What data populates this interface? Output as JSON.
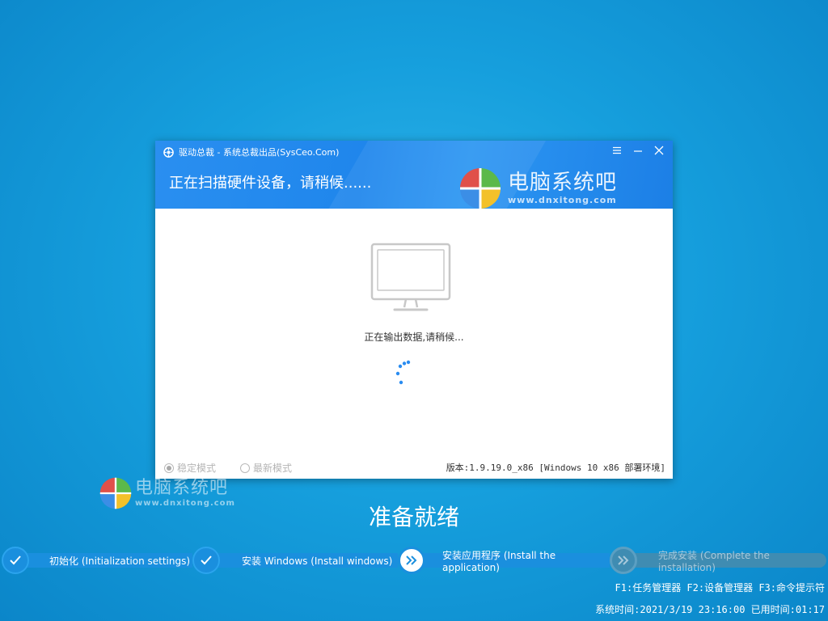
{
  "window": {
    "title": "驱动总裁 - 系统总裁出品(SysCeo.Com)",
    "message": "正在扫描硬件设备，请稍候......",
    "controls": [
      "menu-icon",
      "minimize-icon",
      "close-icon"
    ]
  },
  "watermark": {
    "title": "电脑系统吧",
    "url": "www.dnxitong.com"
  },
  "content": {
    "status": "正在输出数据,请稍候..."
  },
  "footer": {
    "modes": [
      {
        "label": "稳定模式",
        "selected": true
      },
      {
        "label": "最新模式",
        "selected": false
      }
    ],
    "version": "版本:1.9.19.0_x86 [Windows 10 x86 部署环境]"
  },
  "desktop": {
    "ready": "准备就绪",
    "steps": [
      {
        "label": "初始化 (Initialization settings)",
        "state": "done",
        "icon": "check-icon"
      },
      {
        "label": "安装 Windows (Install windows)",
        "state": "done",
        "icon": "check-icon"
      },
      {
        "label": "安装应用程序 (Install the application)",
        "state": "active",
        "icon": "double-chevron-icon"
      },
      {
        "label": "完成安装 (Complete the installation)",
        "state": "pending",
        "icon": "double-chevron-icon"
      }
    ],
    "shortcuts": "F1:任务管理器 F2:设备管理器 F3:命令提示符",
    "time": "系统时间:2021/3/19 23:16:00 已用时间:01:17"
  },
  "colors": {
    "accent": "#1f86ec",
    "step_bar": "#1a8fde",
    "step_pending": "#3f8cb2"
  }
}
